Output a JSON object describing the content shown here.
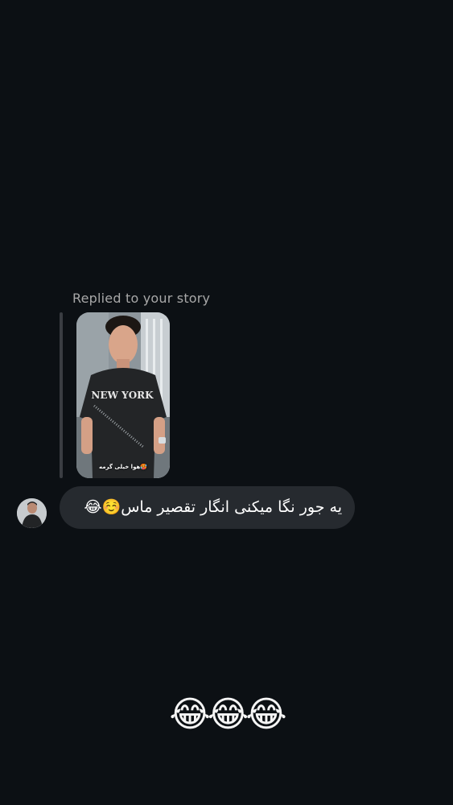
{
  "conversation": {
    "reply_context": {
      "label": "Replied to your story",
      "story_caption": "هوا خیلی گرمه🥵",
      "story_shirt_text": "NEW YORK"
    },
    "messages": [
      {
        "sender": "other",
        "type": "text",
        "text": "یه جور نگا میکنی انگار تقصیر ماس☺️😂"
      },
      {
        "sender": "other",
        "type": "emoji",
        "text": "😂😂😂"
      }
    ]
  },
  "icons": {
    "avatar": "user-avatar-icon"
  }
}
